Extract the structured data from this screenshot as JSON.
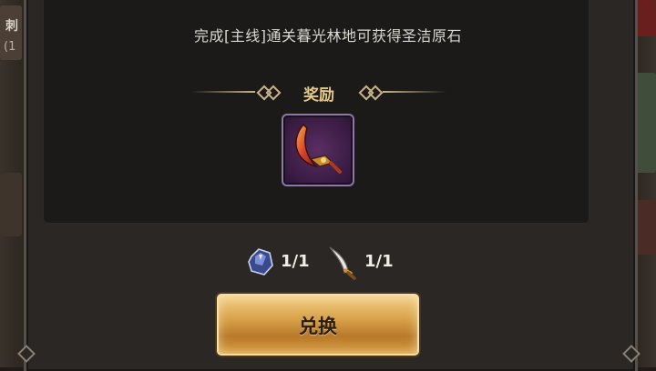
{
  "quest": {
    "description": "完成[主线]通关暮光林地可获得圣洁原石"
  },
  "reward": {
    "title": "奖励",
    "item_icon": "crescent-blade-icon"
  },
  "costs": [
    {
      "icon": "blue-gem-stone-icon",
      "count": "1/1"
    },
    {
      "icon": "curved-dagger-icon",
      "count": "1/1"
    }
  ],
  "actions": {
    "exchange_label": "兑换"
  },
  "side_fragments": {
    "left_top": "刺",
    "left_sub": "(1"
  },
  "colors": {
    "accent_gold": "#e6c98a",
    "button_gold": "#d8a24a",
    "item_bg": "#5a2e63"
  }
}
